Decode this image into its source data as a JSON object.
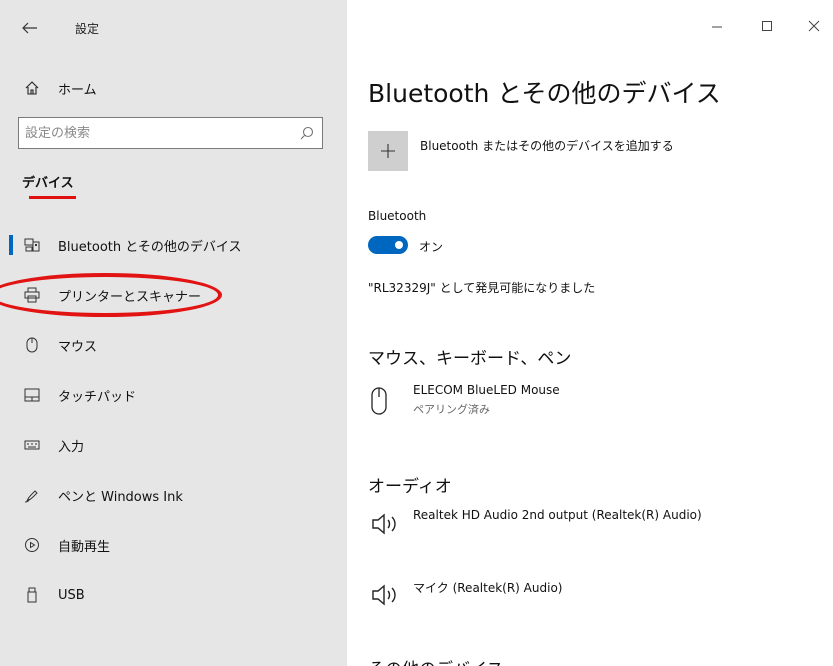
{
  "window": {
    "title": "設定",
    "controls": {
      "minimize": "—",
      "maximize": "☐",
      "close": "✕"
    }
  },
  "nav": {
    "back_icon": "back-arrow-icon",
    "home_label": "ホーム",
    "search_placeholder": "設定の検索",
    "section_title": "デバイス",
    "items": [
      {
        "label": "Bluetooth とその他のデバイス",
        "icon": "bluetooth-devices-icon",
        "selected": true
      },
      {
        "label": "プリンターとスキャナー",
        "icon": "printer-icon",
        "selected": false
      },
      {
        "label": "マウス",
        "icon": "mouse-icon",
        "selected": false
      },
      {
        "label": "タッチパッド",
        "icon": "touchpad-icon",
        "selected": false
      },
      {
        "label": "入力",
        "icon": "keyboard-icon",
        "selected": false
      },
      {
        "label": "ペンと Windows Ink",
        "icon": "pen-icon",
        "selected": false
      },
      {
        "label": "自動再生",
        "icon": "autoplay-icon",
        "selected": false
      },
      {
        "label": "USB",
        "icon": "usb-icon",
        "selected": false
      }
    ]
  },
  "main": {
    "title": "Bluetooth とその他のデバイス",
    "add_device_label": "Bluetooth またはその他のデバイスを追加する",
    "bluetooth": {
      "heading": "Bluetooth",
      "state_label": "オン",
      "enabled": true,
      "discoverable_text": "\"RL32329J\" として発見可能になりました"
    },
    "groups": {
      "mouse_keyboard_pen": {
        "title": "マウス、キーボード、ペン",
        "devices": [
          {
            "name": "ELECOM BlueLED Mouse",
            "status": "ペアリング済み",
            "icon": "mouse-icon"
          }
        ]
      },
      "audio": {
        "title": "オーディオ",
        "devices": [
          {
            "name": "Realtek HD Audio 2nd output (Realtek(R) Audio)",
            "icon": "speaker-icon"
          },
          {
            "name": "マイク (Realtek(R) Audio)",
            "icon": "speaker-icon"
          }
        ]
      },
      "other": {
        "title": "その他のデバイス"
      }
    }
  },
  "colors": {
    "accent": "#0067c0",
    "annotation": "#e01010",
    "sidebar_bg": "#e6e6e6"
  }
}
